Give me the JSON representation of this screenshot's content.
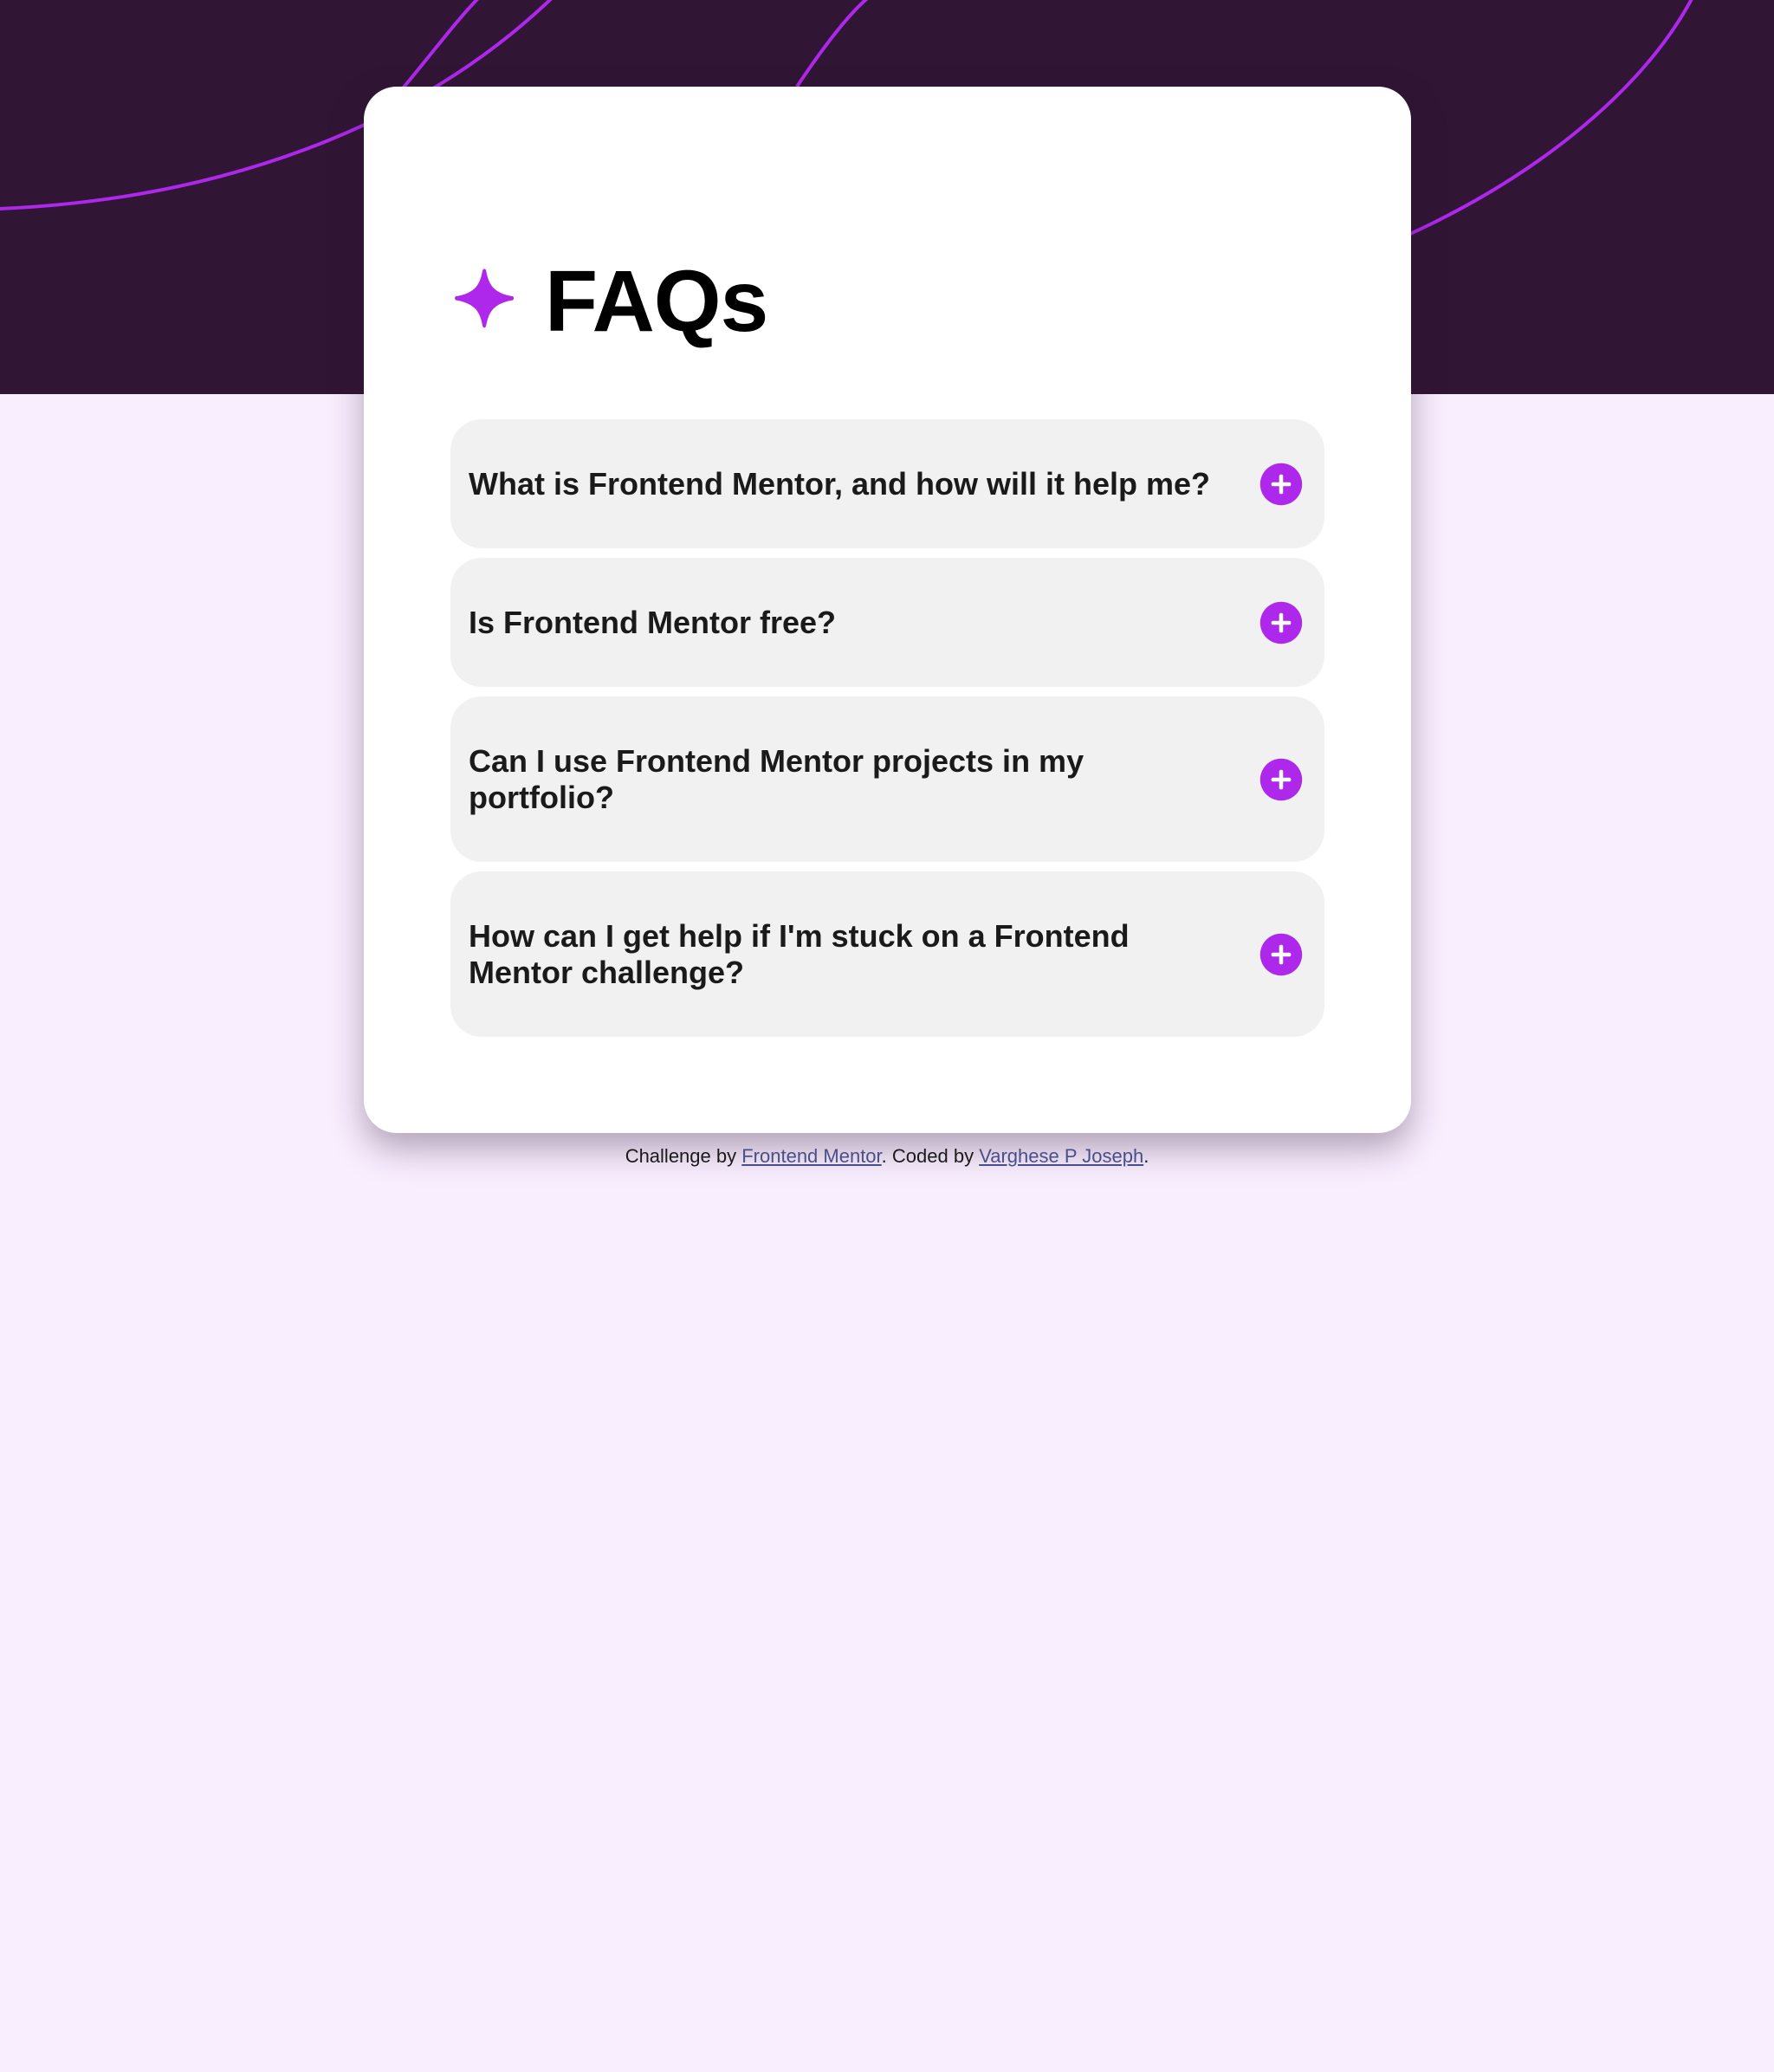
{
  "faq": {
    "title": "FAQs",
    "icon": "star-icon",
    "expand_icon": "plus-icon",
    "items": [
      {
        "question": "What is Frontend Mentor, and how will it help me?"
      },
      {
        "question": "Is Frontend Mentor free?"
      },
      {
        "question": "Can I use Frontend Mentor projects in my portfolio?"
      },
      {
        "question": "How can I get help if I'm stuck on a Frontend Mentor challenge?"
      }
    ]
  },
  "footer": {
    "prefix": "Challenge by ",
    "link1": "Frontend Mentor",
    "middle": ". Coded by ",
    "link2": "Varghese P Joseph",
    "suffix": "."
  },
  "colors": {
    "accent": "#ad28eb",
    "hero_bg": "#301534",
    "page_bg": "#f8eefe",
    "card_bg": "#ffffff",
    "item_bg": "#f1f1f1"
  }
}
